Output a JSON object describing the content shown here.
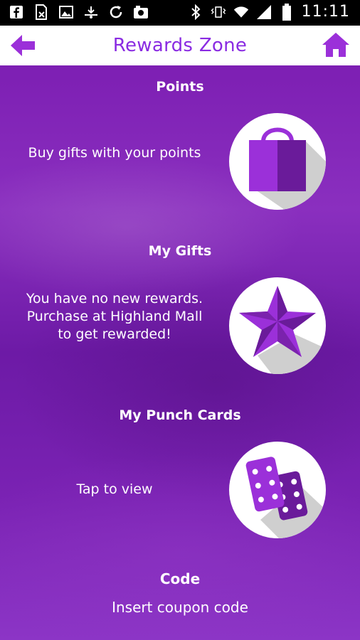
{
  "status_bar": {
    "time": "11:11",
    "left_icons": [
      "facebook-icon",
      "sim-blocked-icon",
      "image-icon",
      "download-icon",
      "sync-icon",
      "camera-icon"
    ],
    "right_icons": [
      "bluetooth-icon",
      "vibrate-icon",
      "wifi-icon",
      "signal-icon",
      "battery-icon"
    ]
  },
  "app_bar": {
    "title": "Rewards Zone",
    "back_icon": "back-arrow-icon",
    "home_icon": "home-icon",
    "accent_color": "#8a2be2"
  },
  "sections": [
    {
      "heading": "Points",
      "text": "Buy gifts with your points",
      "icon": "shopping-bag-icon"
    },
    {
      "heading": "My Gifts",
      "text": "You have no new rewards. Purchase at Highland Mall to get rewarded!",
      "icon": "star-icon"
    },
    {
      "heading": "My Punch Cards",
      "text": "Tap to view",
      "icon": "punch-cards-icon"
    }
  ],
  "code": {
    "heading": "Code",
    "link_text": "Insert coupon code"
  },
  "colors": {
    "background": "#7d1fb3",
    "icon_purple": "#9b30d9",
    "icon_dark_purple": "#6a1b9a",
    "circle_bg": "#ffffff",
    "shadow": "#cfcfcf"
  }
}
